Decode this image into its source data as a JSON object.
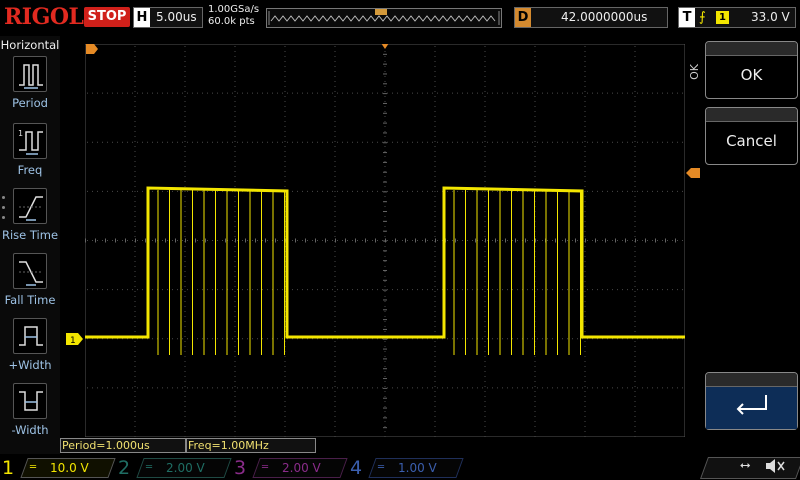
{
  "top": {
    "brand": "RIGOL",
    "run_state": "STOP",
    "timebase_label": "H",
    "timebase_value": "5.00us",
    "sample_rate": "1.00GSa/s",
    "memory_depth": "60.0k pts",
    "delay_label": "D",
    "delay_value": "42.0000000us",
    "trigger_label": "T",
    "trigger_source": "1",
    "trigger_level": "33.0 V"
  },
  "left_menu": {
    "title": "Horizontal",
    "items": [
      {
        "label": "Period",
        "icon": "period-icon"
      },
      {
        "label": "Freq",
        "icon": "freq-icon"
      },
      {
        "label": "Rise Time",
        "icon": "rise-time-icon"
      },
      {
        "label": "Fall Time",
        "icon": "fall-time-icon"
      },
      {
        "label": "+Width",
        "icon": "positive-width-icon"
      },
      {
        "label": "-Width",
        "icon": "negative-width-icon"
      }
    ]
  },
  "right_menu": {
    "side_label": "OK",
    "ok_label": "OK",
    "cancel_label": "Cancel",
    "enter_icon": "enter-icon"
  },
  "markers": {
    "ch1_ground": "1"
  },
  "measurements": {
    "period": "Period=1.000us",
    "freq": "Freq=1.00MHz"
  },
  "channels": [
    {
      "num": "1",
      "value": "10.0 V",
      "color": "#f3e600",
      "active": true
    },
    {
      "num": "2",
      "value": "2.00 V",
      "color": "#1f9e8f",
      "active": false
    },
    {
      "num": "3",
      "value": "2.00 V",
      "color": "#c63cc6",
      "active": false
    },
    {
      "num": "4",
      "value": "1.00 V",
      "color": "#3b6fd6",
      "active": false
    }
  ],
  "colors": {
    "ch1": "#f3e600",
    "marker": "#e58a25",
    "brand": "#e12a20",
    "menu_label": "#9ec3e6"
  }
}
